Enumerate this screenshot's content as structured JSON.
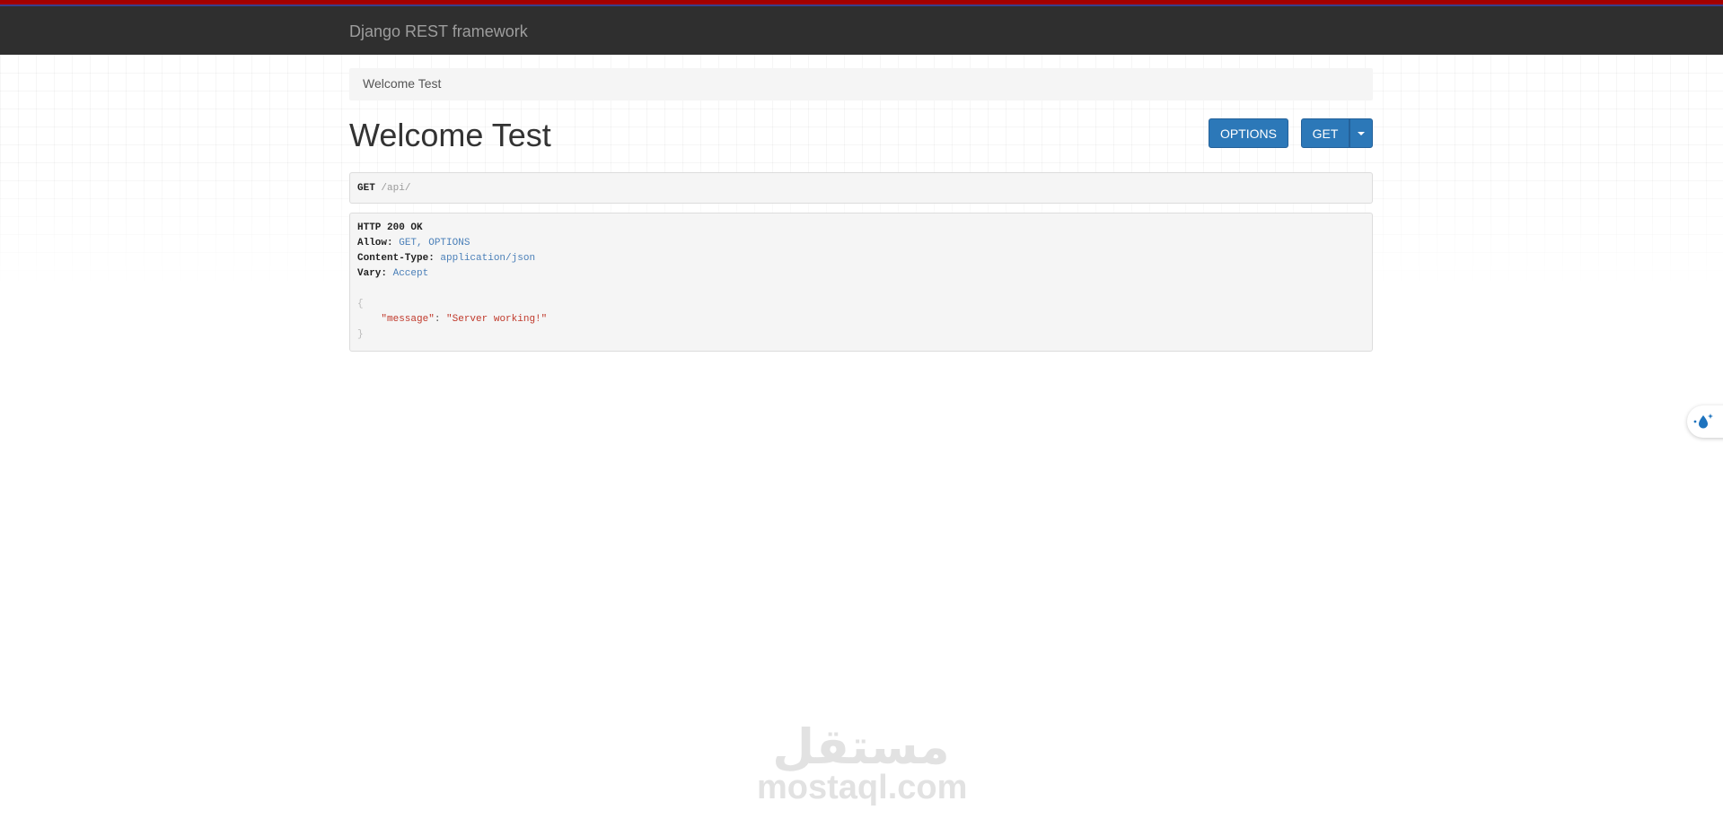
{
  "navbar": {
    "brand": "Django REST framework"
  },
  "breadcrumb": {
    "current": "Welcome Test"
  },
  "page": {
    "title": "Welcome Test"
  },
  "toolbar": {
    "options_label": "OPTIONS",
    "get_label": "GET"
  },
  "request": {
    "method": "GET",
    "path": "/api/"
  },
  "response": {
    "status": "HTTP 200 OK",
    "headers": [
      {
        "key": "Allow",
        "value": "GET, OPTIONS"
      },
      {
        "key": "Content-Type",
        "value": "application/json"
      },
      {
        "key": "Vary",
        "value": "Accept"
      }
    ],
    "body": {
      "open": "{",
      "key": "\"message\"",
      "colon": ": ",
      "value": "\"Server working!\"",
      "close": "}"
    }
  },
  "watermark": {
    "arabic": "مستقل",
    "latin": "mostaql.com"
  },
  "colors": {
    "navbar": "#2f2f2f",
    "navbar_stripe": "#a30000",
    "button": "#2c78b8",
    "header_value": "#4a7fb8",
    "json_string": "#c0392b"
  }
}
